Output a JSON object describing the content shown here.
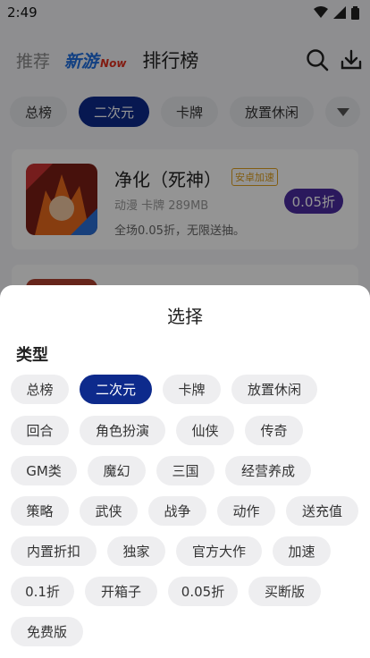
{
  "status_bar": {
    "time": "2:49"
  },
  "header": {
    "tab_recommend": "推荐",
    "logo_main": "新游",
    "logo_sub": "Now",
    "tab_ranking": "排行榜"
  },
  "categories": [
    "总榜",
    "二次元",
    "卡牌",
    "放置休闲"
  ],
  "selected_category": "二次元",
  "games": [
    {
      "title": "净化（死神）",
      "tag": "安卓加速",
      "meta": "动漫 卡牌 289MB",
      "desc": "全场0.05折，无限送抽。",
      "discount": "0.05折"
    }
  ],
  "sheet": {
    "title": "选择",
    "section_label": "类型",
    "options": [
      "总榜",
      "二次元",
      "卡牌",
      "放置休闲",
      "回合",
      "角色扮演",
      "仙侠",
      "传奇",
      "GM类",
      "魔幻",
      "三国",
      "经营养成",
      "策略",
      "武侠",
      "战争",
      "动作",
      "送充值",
      "内置折扣",
      "独家",
      "官方大作",
      "加速",
      "0.1折",
      "开箱子",
      "0.05折",
      "买断版",
      "免费版"
    ],
    "selected": "二次元"
  },
  "colors": {
    "accent": "#0d2a8c",
    "discount_badge": "#4a2ca0",
    "tag": "#e0a020"
  }
}
